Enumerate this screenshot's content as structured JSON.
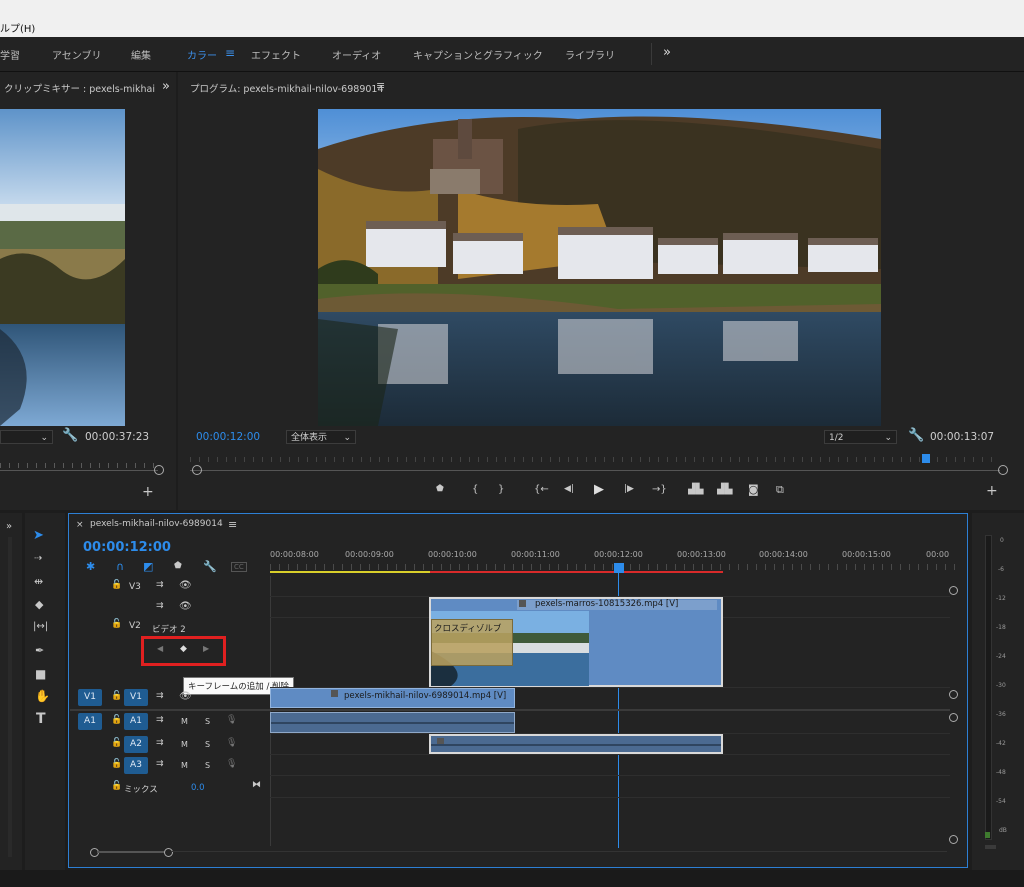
{
  "menubar": {
    "help": "ルプ(H)"
  },
  "workspaces": [
    {
      "label": "学習",
      "active": false
    },
    {
      "label": "アセンブリ",
      "active": false
    },
    {
      "label": "編集",
      "active": false
    },
    {
      "label": "カラー",
      "active": true
    },
    {
      "label": "エフェクト",
      "active": false
    },
    {
      "label": "オーディオ",
      "active": false
    },
    {
      "label": "キャプションとグラフィック",
      "active": false
    },
    {
      "label": "ライブラリ",
      "active": false
    }
  ],
  "workspaces_more": "»",
  "source": {
    "title": "クリップミキサー : pexels-mikhai",
    "more": "»",
    "timecode": "00:00:37:23"
  },
  "program": {
    "title": "プログラム: pexels-mikhail-nilov-6989014",
    "menu": "≡",
    "timecode_left": "00:00:12:00",
    "fit": "全体表示",
    "resolution": "1/2",
    "timecode_right": "00:00:13:07"
  },
  "timeline": {
    "close": "×",
    "seq_name": "pexels-mikhail-nilov-6989014",
    "menu": "≡",
    "timecode": "00:00:12:00",
    "ruler": [
      "00:00:08:00",
      "00:00:09:00",
      "00:00:10:00",
      "00:00:11:00",
      "00:00:12:00",
      "00:00:13:00",
      "00:00:14:00",
      "00:00:15:00",
      "00:00"
    ],
    "tracks": {
      "v3": "V3",
      "v2": "V2",
      "v1": "V1",
      "v1src": "V1",
      "a1": "A1",
      "a1src": "A1",
      "a2": "A2",
      "a3": "A3",
      "video2_name": "ビデオ 2",
      "mix": "ミックス",
      "mix_value": "0.0",
      "m": "M",
      "s": "S"
    },
    "clips": {
      "v2_clip": "pexels-marros-10815326.mp4 [V]",
      "v1_clip": "pexels-mikhail-nilov-6989014.mp4 [V]",
      "transition": "クロスディゾルブ"
    },
    "tooltip": "キーフレームの追加 / 削除"
  },
  "meter": {
    "labels": [
      "0",
      "-6",
      "-12",
      "-18",
      "-24",
      "-30",
      "-36",
      "-42",
      "-48",
      "-54",
      "dB"
    ]
  },
  "colors": {
    "accent": "#2d8ceb",
    "highlight": "#e02020"
  },
  "icons": {
    "selection": "arrow-select-icon",
    "track-select": "track-select-icon",
    "ripple": "ripple-edit-icon",
    "razor": "razor-icon",
    "slip": "slip-icon",
    "pen": "pen-icon",
    "rect": "rectangle-icon",
    "hand": "hand-icon",
    "type": "type-icon"
  }
}
